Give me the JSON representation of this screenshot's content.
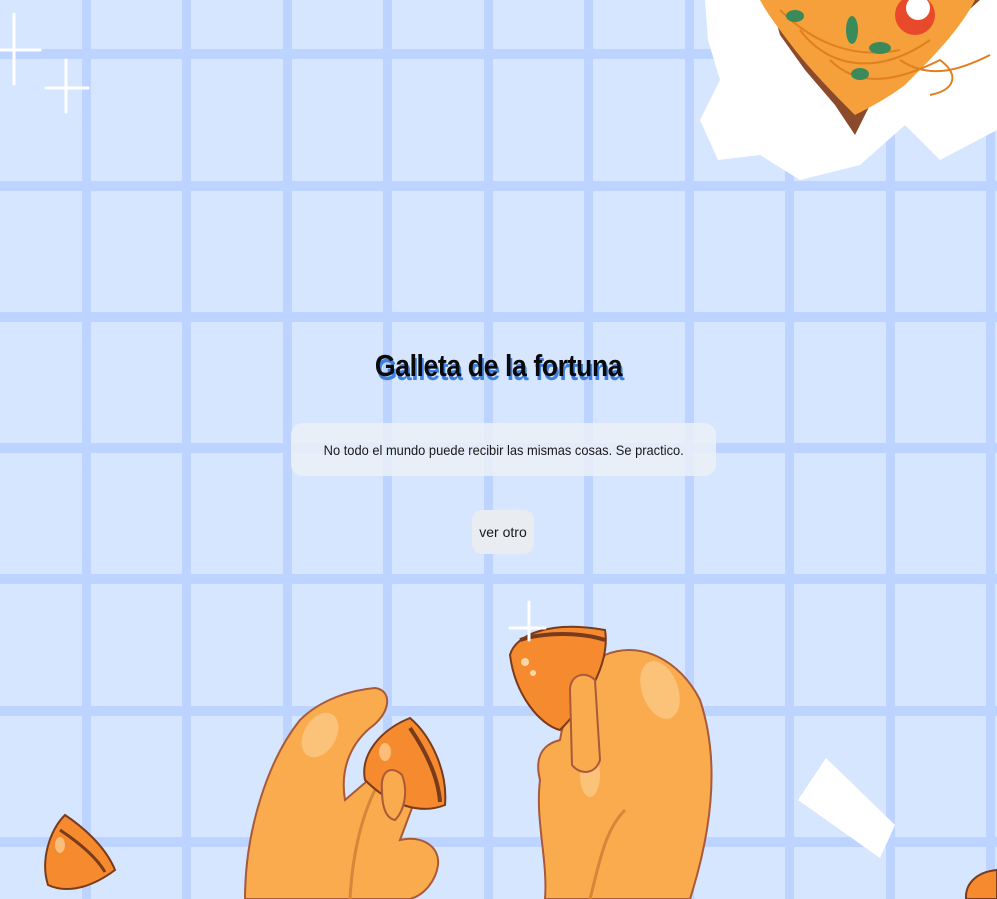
{
  "page": {
    "title": "Galleta de la fortuna",
    "fortune": "No todo el mundo puede recibir las mismas cosas. Se practico.",
    "button_label": "ver otro"
  },
  "colors": {
    "background": "#d6e6ff",
    "grid_line": "#bcd4ff",
    "title_shadow": "#3f7fe0",
    "cookie": "#f58a2e",
    "hand": "#f9ab4e"
  },
  "icons": {
    "cookie": "fortune-cookie-icon",
    "noodles": "noodle-box-icon",
    "sparkle": "sparkle-icon"
  }
}
